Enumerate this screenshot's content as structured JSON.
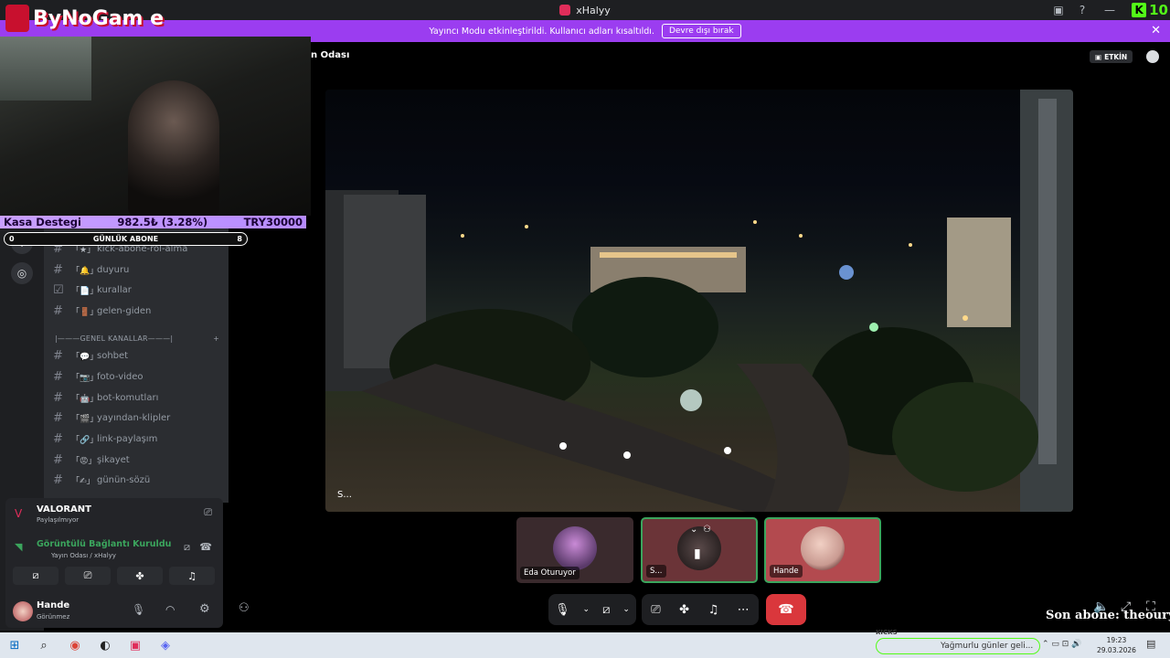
{
  "window": {
    "title": "xHalyy",
    "kick_count": "10"
  },
  "banner": {
    "message": "Yayıncı Modu etkinleştirildi. Kullanıcı adları kısaltıldı.",
    "button": "Devre dışı bırak"
  },
  "overlay": {
    "logo_text": "ByNoGam e",
    "donation": {
      "label": "Kasa Destegi",
      "amount": "982.5₺ (3.28%)",
      "goal": "TRY30000"
    },
    "daily_subs": {
      "label": "GÜNLÜK ABONE",
      "min": "0",
      "max": "8",
      "progress_fraction": 0.0
    },
    "last_sub": "Son abone: theouryun"
  },
  "channels": {
    "partial_top": "kick-abone-rol-alma",
    "items_top": [
      {
        "emoji": "「🔔」",
        "name": "duyuru"
      },
      {
        "emoji": "「📄」",
        "name": "kurallar"
      },
      {
        "emoji": "「🚪」",
        "name": "gelen-giden"
      }
    ],
    "category": "|———GENEL KANALLAR———|",
    "items": [
      {
        "emoji": "「💬」",
        "name": "sohbet"
      },
      {
        "emoji": "「📷」",
        "name": "foto-video"
      },
      {
        "emoji": "「🤖」",
        "name": "bot-komutları"
      },
      {
        "emoji": "「🎬」",
        "name": "yayından-klipler"
      },
      {
        "emoji": "「🔗」",
        "name": "link-paylaşım"
      },
      {
        "emoji": "「😡」",
        "name": "şikayet"
      },
      {
        "emoji": "「✍」",
        "name": "günün-sözü"
      }
    ]
  },
  "voice_panel": {
    "activity": "VALORANT",
    "activity_sub": "Paylaşılmıyor",
    "connection": "Görüntülü Bağlantı Kuruldu",
    "connection_sub": "Yayın Odası / xHalyy",
    "user_name": "Hande",
    "user_status": "Görünmez"
  },
  "stage": {
    "room_title": "n Odası",
    "etkin_label": "ETKİN",
    "main_video_label": "S...",
    "tiles": [
      {
        "name": "Eda Oturuyor"
      },
      {
        "name": "S..."
      },
      {
        "name": "Hande"
      }
    ]
  },
  "taskbar": {
    "kick_label": "KICKS",
    "marquee": "Yağmurlu günler geli...",
    "time": "19:23",
    "date": "29.03.2026"
  },
  "colors": {
    "banner": "#9b3df0",
    "hangup": "#da373c",
    "speaking_border": "#3ba55d",
    "kick_green": "#53fc18"
  }
}
